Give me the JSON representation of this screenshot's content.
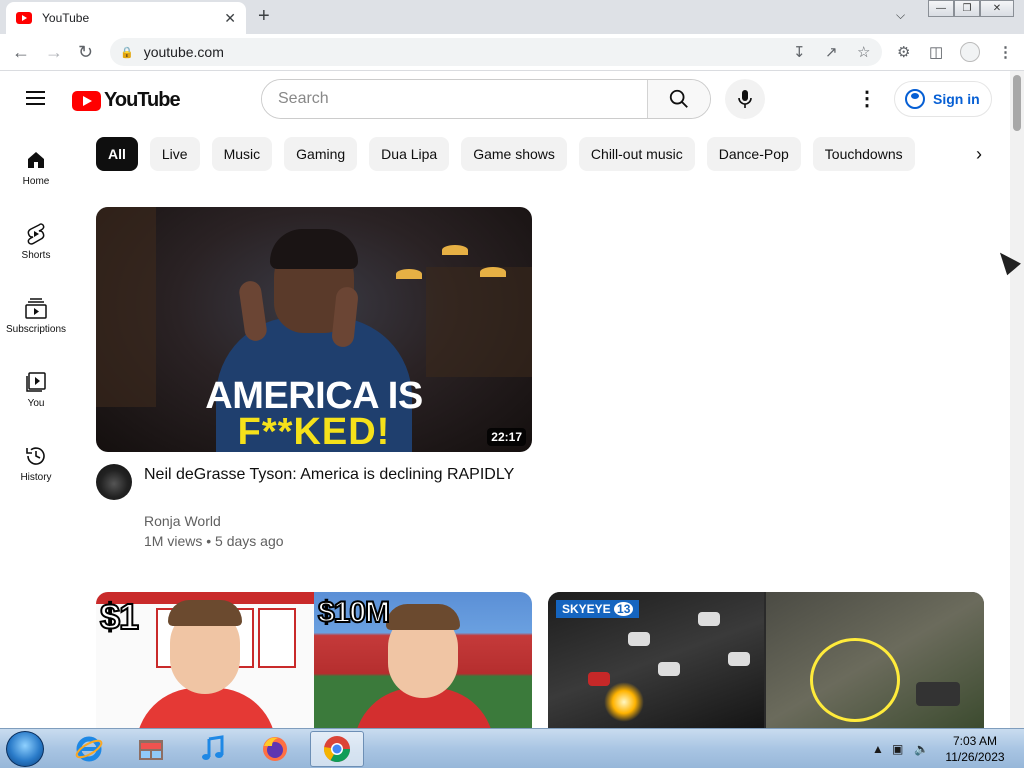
{
  "browser": {
    "tab_title": "YouTube",
    "tab_close": "✕",
    "new_tab": "+",
    "url": "youtube.com"
  },
  "masthead": {
    "logo_text": "YouTube",
    "search_placeholder": "Search",
    "signin_label": "Sign in"
  },
  "chips": [
    "All",
    "Live",
    "Music",
    "Gaming",
    "Dua Lipa",
    "Game shows",
    "Chill-out music",
    "Dance-Pop",
    "Touchdowns"
  ],
  "rail": [
    {
      "label": "Home",
      "icon": "home-icon"
    },
    {
      "label": "Shorts",
      "icon": "shorts-icon"
    },
    {
      "label": "Subscriptions",
      "icon": "subscriptions-icon"
    },
    {
      "label": "You",
      "icon": "you-icon"
    },
    {
      "label": "History",
      "icon": "history-icon"
    }
  ],
  "videos": [
    {
      "thumb_line1": "AMERICA IS",
      "thumb_line2": "F**KED!",
      "duration": "22:17",
      "title": "Neil deGrasse Tyson: America is declining RAPIDLY",
      "channel": "Ronja World",
      "views": "1M views",
      "age": "5 days ago"
    },
    {
      "thumb_left_text": "$1",
      "thumb_right_text": "$10M"
    },
    {
      "badge": "SKYEYE",
      "badge_num": "13"
    }
  ],
  "taskbar": {
    "time": "7:03 AM",
    "date": "11/26/2023"
  },
  "colors": {
    "brand_red": "#ff0000",
    "link_blue": "#065fd4",
    "chip_active": "#0f0f0f",
    "chip_bg": "#f2f2f2"
  }
}
